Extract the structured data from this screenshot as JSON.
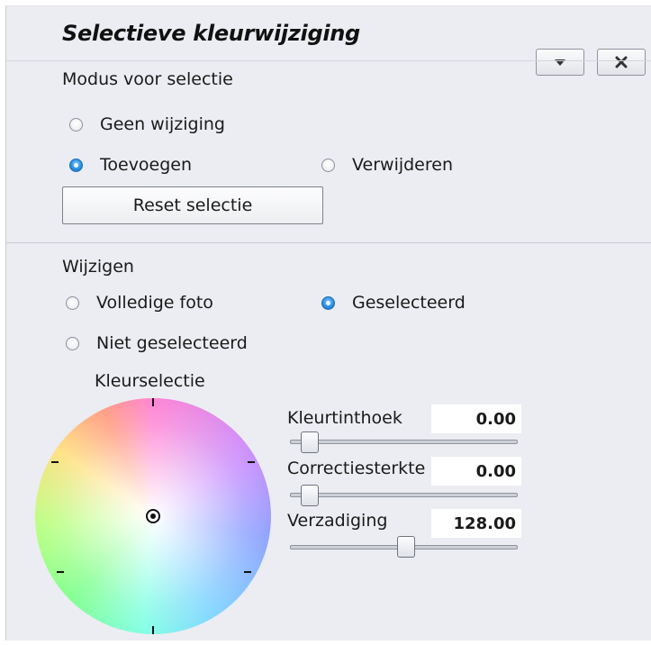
{
  "panel": {
    "title": "Selectieve kleurwijziging",
    "header_buttons": {
      "collapse_icon": "triangle-down-icon",
      "close_icon": "close-x-icon"
    }
  },
  "selection_mode": {
    "heading": "Modus voor selectie",
    "options": [
      {
        "label": "Geen wijziging",
        "selected": false
      },
      {
        "label": "Toevoegen",
        "selected": true
      },
      {
        "label": "Verwijderen",
        "selected": false
      }
    ],
    "reset_button": "Reset selectie"
  },
  "modify": {
    "heading": "Wijzigen",
    "options": [
      {
        "label": "Volledige foto",
        "selected": false
      },
      {
        "label": "Geselecteerd",
        "selected": true
      },
      {
        "label": "Niet geselecteerd",
        "selected": false
      }
    ]
  },
  "color_selection": {
    "heading": "Kleurselectie"
  },
  "sliders": [
    {
      "label": "Kleurtinthoek",
      "value": "0.00",
      "fraction": 0.0
    },
    {
      "label": "Correctiesterkte",
      "value": "0.00",
      "fraction": 0.0
    },
    {
      "label": "Verzadiging",
      "value": "128.00",
      "fraction": 0.5
    }
  ],
  "colors": {
    "panel_bg": "#ebedf2",
    "radio_selected": "#2b8fe0"
  }
}
